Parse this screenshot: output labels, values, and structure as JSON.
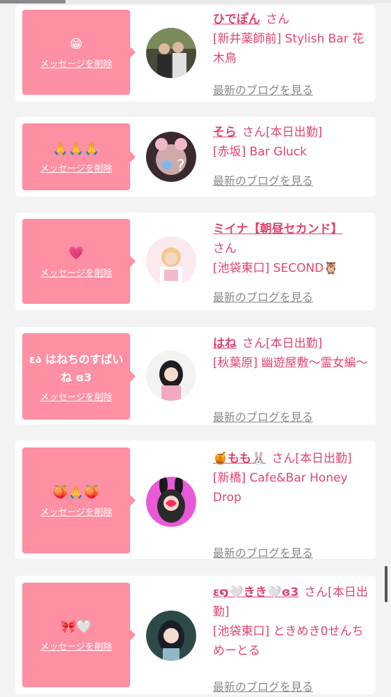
{
  "cards": [
    {
      "message": "😁",
      "delete_label": "メッセージを削除",
      "name": "ひでぽん",
      "san": "さん",
      "shop": "[新井薬師前] Stylish Bar 花木鳥",
      "blog_label": "最新のブログを見る"
    },
    {
      "message": "🙏🙏🙏",
      "delete_label": "メッセージを削除",
      "name": "そら",
      "san": "さん[本日出勤]",
      "shop": "[赤坂] Bar Gluck",
      "blog_label": "最新のブログを見る"
    },
    {
      "message": "💗",
      "delete_label": "メッセージを削除",
      "name": "ミイナ【朝昼セカンド】",
      "san": "さん",
      "shop": "[池袋東口] SECOND🦉",
      "blog_label": "最新のブログを見る"
    },
    {
      "message": "εა はねちのすばいね ɞ3",
      "delete_label": "メッセージを削除",
      "name": "はね",
      "san": "さん[本日出勤]",
      "shop": "[秋葉原] 幽遊屋敷～霊女編～",
      "blog_label": "最新のブログを見る"
    },
    {
      "message": "🍑🙏🍑",
      "delete_label": "メッセージを削除",
      "name": "🍯もも🐰",
      "san": "さん[本日出勤]",
      "shop": "[新橋] Cafe&Bar Honey Drop",
      "blog_label": "最新のブログを見る"
    },
    {
      "message": "🎀🤍",
      "delete_label": "メッセージを削除",
      "name": "ε໑🤍きき🤍ɞ3",
      "san": "さん[本日出勤]",
      "shop": "[池袋東口] ときめき0せんちめーとる",
      "blog_label": "最新のブログを見る"
    }
  ],
  "colors": {
    "accent": "#e0446d",
    "bubble": "#ff8fa3",
    "link_gray": "#8a8a8a",
    "background": "#f3f3f3"
  }
}
